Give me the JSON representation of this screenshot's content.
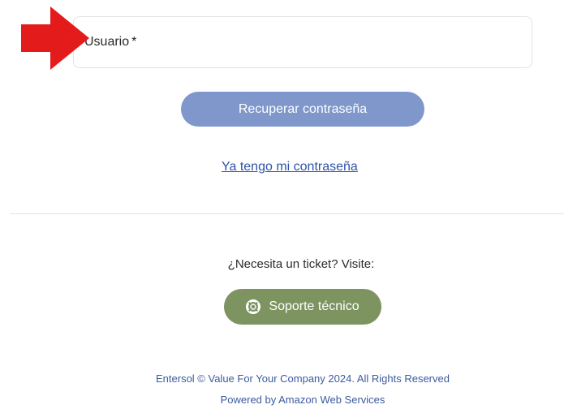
{
  "form": {
    "user_label": "Usuario",
    "required_marker": "*"
  },
  "actions": {
    "recover_label": "Recuperar contraseña",
    "have_password_link": "Ya tengo mi contraseña"
  },
  "support": {
    "prompt": "¿Necesita un ticket? Visite:",
    "button_label": "Soporte técnico",
    "icon": "lifebuoy-icon"
  },
  "footer": {
    "copyright": "Entersol © Value For Your Company 2024. All Rights Reserved",
    "powered_by": "Powered by Amazon Web Services"
  },
  "colors": {
    "primary_button": "#7f97cb",
    "support_button": "#7d9460",
    "link": "#2f52a8",
    "footer_text": "#3c5ba0",
    "arrow": "#e31b1b"
  }
}
